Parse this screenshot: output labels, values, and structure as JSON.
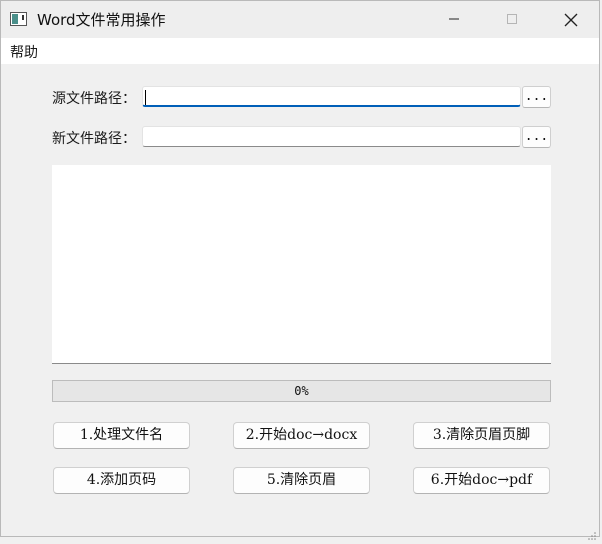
{
  "window": {
    "title": "Word文件常用操作"
  },
  "menu": {
    "items": [
      "帮助"
    ]
  },
  "form": {
    "source_label": "源文件路径：",
    "source_value": "",
    "target_label": "新文件路径：",
    "target_value": "",
    "browse_label": "..."
  },
  "progress": {
    "value": 0,
    "text": "0%"
  },
  "actions": {
    "btn1": "1.处理文件名",
    "btn2": "2.开始doc→docx",
    "btn3": "3.清除页眉页脚",
    "btn4": "4.添加页码",
    "btn5": "5.清除页眉",
    "btn6": "6.开始doc→pdf"
  },
  "colors": {
    "accent": "#005fb8",
    "background": "#f0f0f0"
  }
}
